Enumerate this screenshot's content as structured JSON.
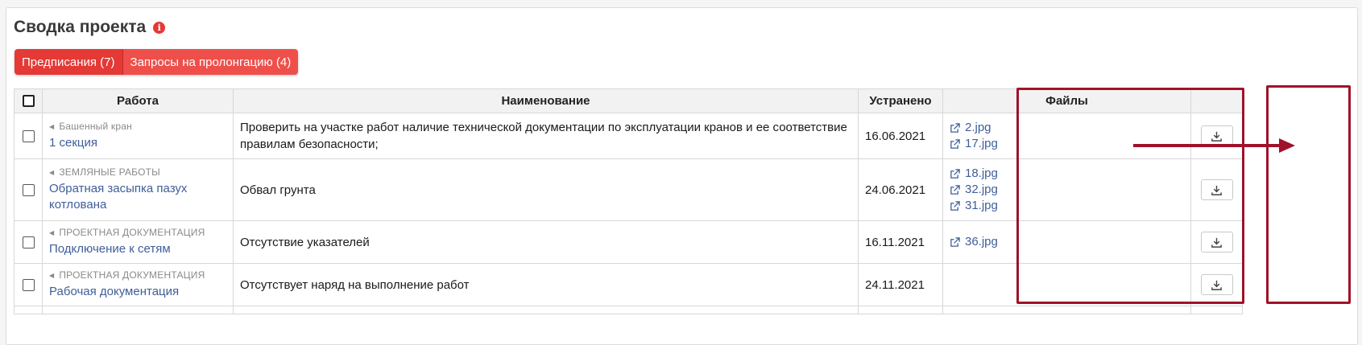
{
  "header": {
    "title": "Сводка проекта",
    "info_icon": "info-icon"
  },
  "tabs": [
    {
      "label": "Предписания (7)"
    },
    {
      "label": "Запросы на пролонгацию (4)"
    }
  ],
  "table": {
    "columns": [
      "",
      "Работа",
      "Наименование",
      "Устранено",
      "Файлы",
      ""
    ],
    "rows": [
      {
        "category": "Башенный кран",
        "work": "1 секция",
        "name": "Проверить на участке работ наличие технической документации по эксплуатации кранов и ее соответствие правилам безопасности;",
        "date": "16.06.2021",
        "files": [
          "2.jpg",
          "17.jpg"
        ]
      },
      {
        "category": "ЗЕМЛЯНЫЕ РАБОТЫ",
        "work": "Обратная засыпка пазух котлована",
        "name": "Обвал грунта",
        "date": "24.06.2021",
        "files": [
          "18.jpg",
          "32.jpg",
          "31.jpg"
        ]
      },
      {
        "category": "ПРОЕКТНАЯ ДОКУМЕНТАЦИЯ",
        "work": "Подключение к сетям",
        "name": "Отсутствие указателей",
        "date": "16.11.2021",
        "files": [
          "36.jpg"
        ]
      },
      {
        "category": "ПРОЕКТНАЯ ДОКУМЕНТАЦИЯ",
        "work": "Рабочая документация",
        "name": "Отсутствует наряд на выполнение работ",
        "date": "24.11.2021",
        "files": []
      }
    ]
  },
  "colors": {
    "accent": "#e53935",
    "link": "#3f5e9a",
    "annotation": "#a0122a"
  }
}
